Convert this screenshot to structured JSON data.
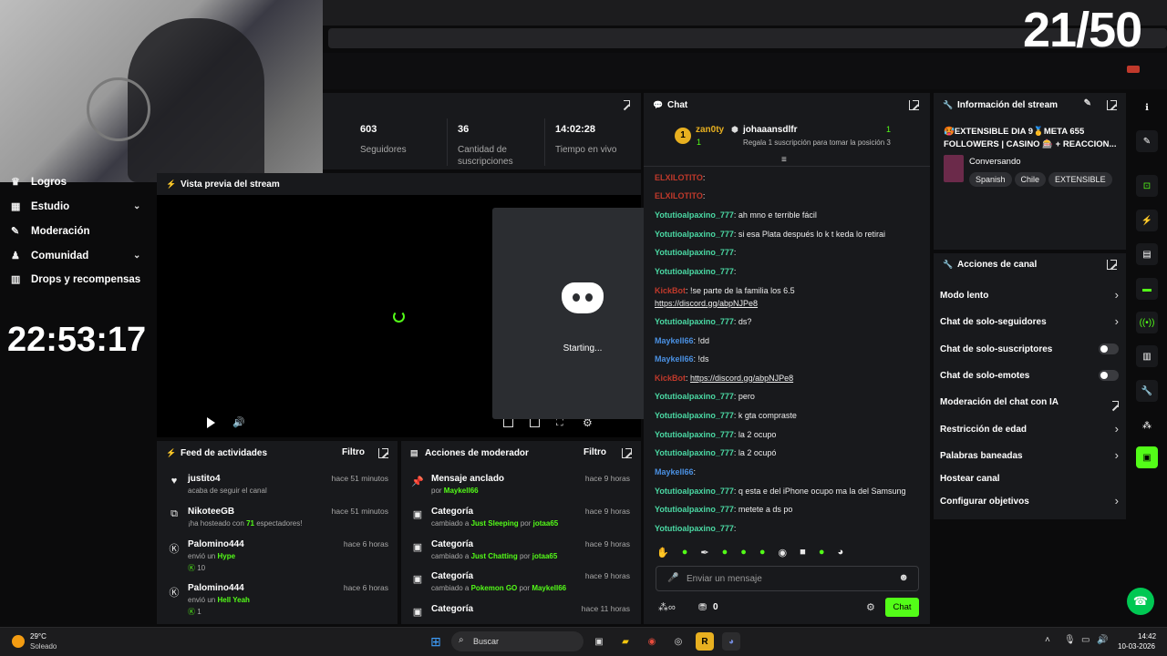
{
  "overlay": {
    "counter": "21/50",
    "clock": "22:53:17"
  },
  "sidebar": {
    "items": [
      {
        "label": "Logros",
        "icon": "trophy-icon"
      },
      {
        "label": "Estudio",
        "icon": "grid-icon",
        "chevron": true
      },
      {
        "label": "Moderación",
        "icon": "wrench-icon"
      },
      {
        "label": "Comunidad",
        "icon": "community-icon",
        "chevron": true
      },
      {
        "label": "Drops y recompensas",
        "icon": "gift-icon"
      }
    ]
  },
  "stats": [
    {
      "value": "603",
      "label": "Seguidores"
    },
    {
      "value": "36",
      "label": "Cantidad de suscripciones"
    },
    {
      "value": "14:02:28",
      "label": "Tiempo en vivo"
    }
  ],
  "preview": {
    "title": "Vista previa del stream"
  },
  "discord_popup": {
    "status": "Starting..."
  },
  "activity_feed": {
    "title": "Feed de actividades",
    "filter_label": "Filtro",
    "items": [
      {
        "user": "justito4",
        "text": "acaba de seguir el canal",
        "time": "hace 51 minutos",
        "icon": "heart-icon"
      },
      {
        "user": "NikoteeGB",
        "text_before": "¡ha hosteado con",
        "count": "71",
        "text_after": "espectadores!",
        "time": "hace 51 minutos",
        "icon": "host-icon"
      },
      {
        "user": "Palomino444",
        "text_before": "envió un",
        "gift": "Hype",
        "kicks": "10",
        "time": "hace 6 horas",
        "icon": "kick-icon"
      },
      {
        "user": "Palomino444",
        "text_before": "envió un",
        "gift": "Hell Yeah",
        "kicks": "1",
        "time": "hace 6 horas",
        "icon": "kick-icon"
      }
    ]
  },
  "mod_actions": {
    "title": "Acciones de moderador",
    "filter_label": "Filtro",
    "items": [
      {
        "title": "Mensaje anclado",
        "prefix": "por",
        "value": "Maykell66",
        "time": "hace 9 horas",
        "icon": "pin-icon"
      },
      {
        "title": "Categoría",
        "prefix": "cambiado a",
        "value": "Just Sleeping",
        "mid": "por",
        "user": "jotaa65",
        "time": "hace 9 horas",
        "icon": "category-icon"
      },
      {
        "title": "Categoría",
        "prefix": "cambiado a",
        "value": "Just Chatting",
        "mid": "por",
        "user": "jotaa65",
        "time": "hace 9 horas",
        "icon": "category-icon"
      },
      {
        "title": "Categoría",
        "prefix": "cambiado a",
        "value": "Pokemon GO",
        "mid": "por",
        "user": "Maykell66",
        "time": "hace 9 horas",
        "icon": "category-icon"
      },
      {
        "title": "Categoría",
        "time": "hace 11 horas",
        "icon": "category-icon"
      }
    ]
  },
  "chat": {
    "title": "Chat",
    "top_gifter": {
      "rank": "1",
      "name": "zan0ty",
      "count": "1"
    },
    "promo": {
      "name": "johaaansdlfr",
      "count": "1",
      "text": "Regala 1 suscripción para tomar la posición 3"
    },
    "messages": [
      {
        "user": "ELXILOTITO",
        "text": "",
        "color": "#c0392b"
      },
      {
        "user": "ELXILOTITO",
        "text": "",
        "color": "#c0392b"
      },
      {
        "user": "Yotutioalpaxino_777",
        "text": "ah mno e terrible fácil"
      },
      {
        "user": "Yotutioalpaxino_777",
        "text": "si esa Plata después lo k t keda lo retirai"
      },
      {
        "user": "Yotutioalpaxino_777",
        "text": ""
      },
      {
        "user": "Yotutioalpaxino_777",
        "text": ""
      },
      {
        "user": "KickBot",
        "text": "!se parte de la familia los 6.5",
        "color": "#c0392b"
      },
      {
        "user": "",
        "text": "https://discord.gg/abpNJPe8"
      },
      {
        "user": "Yotutioalpaxino_777",
        "text": "ds?"
      },
      {
        "user": "Maykell66",
        "text": "!dd",
        "color": "#4a90e2"
      },
      {
        "user": "Maykell66",
        "text": "!ds",
        "color": "#4a90e2"
      },
      {
        "user": "KickBot",
        "text": "https://discord.gg/abpNJPe8",
        "color": "#c0392b"
      },
      {
        "user": "Yotutioalpaxino_777",
        "text": "pero"
      },
      {
        "user": "Yotutioalpaxino_777",
        "text": "k gta compraste"
      },
      {
        "user": "Yotutioalpaxino_777",
        "text": "la 2 ocupo"
      },
      {
        "user": "Yotutioalpaxino_777",
        "text": "la 2 ocupó"
      },
      {
        "user": "Maykell66",
        "text": "",
        "color": "#4a90e2"
      },
      {
        "user": "Yotutioalpaxino_777",
        "text": "q esta e del iPhone ocupo ma la del Samsung"
      },
      {
        "user": "Yotutioalpaxino_777",
        "text": "metete a ds po"
      },
      {
        "user": "Yotutioalpaxino_777",
        "text": ""
      }
    ],
    "input_placeholder": "Enviar un mensaje",
    "points": "0",
    "send_label": "Chat"
  },
  "stream_info": {
    "title": "Información del stream",
    "stream_title": "🥵EXTENSIBLE DIA 9🥇META 655 FOLLOWERS | CASINO 🎰 + REACCION...",
    "category": "Conversando",
    "tags": [
      "Spanish",
      "Chile",
      "EXTENSIBLE"
    ]
  },
  "channel_actions": {
    "title": "Acciones de canal",
    "items": [
      {
        "label": "Modo lento",
        "control": "chevron"
      },
      {
        "label": "Chat de solo-seguidores",
        "control": "chevron"
      },
      {
        "label": "Chat de solo-suscriptores",
        "control": "toggle"
      },
      {
        "label": "Chat de solo-emotes",
        "control": "toggle"
      },
      {
        "label": "Moderación del chat con IA",
        "control": "external"
      },
      {
        "label": "Restricción de edad",
        "control": "chevron"
      },
      {
        "label": "Palabras baneadas",
        "control": "chevron"
      },
      {
        "label": "Hostear canal",
        "control": "none"
      },
      {
        "label": "Configurar objetivos",
        "control": "chevron"
      }
    ]
  },
  "taskbar": {
    "weather_temp": "29°C",
    "weather_text": "Soleado",
    "search_placeholder": "Buscar",
    "time": "14:42",
    "date": "10-03-2026"
  },
  "colors": {
    "accent": "#53fc18",
    "panel": "#18191c",
    "bg": "#0b0b0c"
  }
}
